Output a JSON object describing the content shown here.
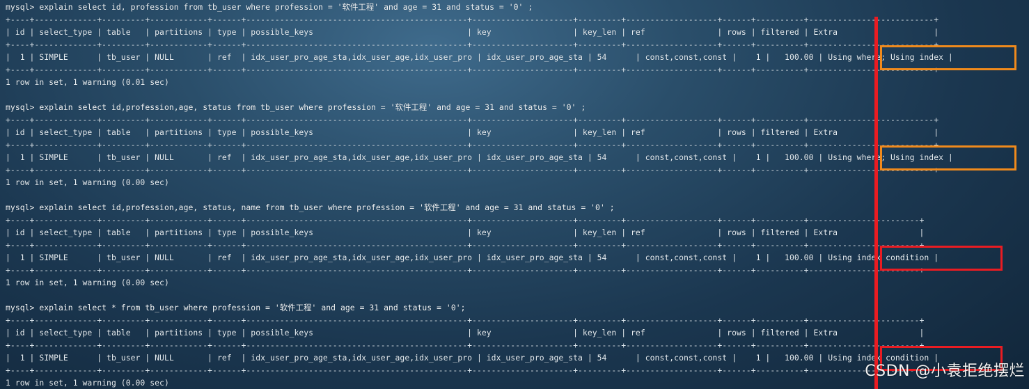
{
  "blocks": [
    {
      "command": "mysql> explain select id, profession from tb_user where profession = '软件工程' and age = 31 and status = '0' ;",
      "separator": "+----+-------------+---------+------------+------+----------------------------------------------+---------------------+---------+-------------------+------+----------+--------------------------+",
      "header": "| id | select_type | table   | partitions | type | possible_keys                                | key                 | key_len | ref               | rows | filtered | Extra                    |",
      "row": "|  1 | SIMPLE      | tb_user | NULL       | ref  | idx_user_pro_age_sta,idx_user_age,idx_user_pro | idx_user_pro_age_sta | 54      | const,const,const |    1 |   100.00 | Using where; Using index |",
      "footer": "1 row in set, 1 warning (0.01 sec)",
      "extra": "Using where; Using index"
    },
    {
      "command": "mysql> explain select id,profession,age, status from tb_user where profession = '软件工程' and age = 31 and status = '0' ;",
      "separator": "+----+-------------+---------+------------+------+----------------------------------------------+---------------------+---------+-------------------+------+----------+--------------------------+",
      "header": "| id | select_type | table   | partitions | type | possible_keys                                | key                 | key_len | ref               | rows | filtered | Extra                    |",
      "row": "|  1 | SIMPLE      | tb_user | NULL       | ref  | idx_user_pro_age_sta,idx_user_age,idx_user_pro | idx_user_pro_age_sta | 54      | const,const,const |    1 |   100.00 | Using where; Using index |",
      "footer": "1 row in set, 1 warning (0.00 sec)",
      "extra": "Using where; Using index"
    },
    {
      "command": "mysql> explain select id,profession,age, status, name from tb_user where profession = '软件工程' and age = 31 and status = '0' ;",
      "separator": "+----+-------------+---------+------------+------+----------------------------------------------+---------------------+---------+-------------------+------+----------+-----------------------+",
      "header": "| id | select_type | table   | partitions | type | possible_keys                                | key                 | key_len | ref               | rows | filtered | Extra                 |",
      "row": "|  1 | SIMPLE      | tb_user | NULL       | ref  | idx_user_pro_age_sta,idx_user_age,idx_user_pro | idx_user_pro_age_sta | 54      | const,const,const |    1 |   100.00 | Using index condition |",
      "footer": "1 row in set, 1 warning (0.00 sec)",
      "extra": "Using index condition"
    },
    {
      "command": "mysql> explain select * from tb_user where profession = '软件工程' and age = 31 and status = '0';",
      "separator": "+----+-------------+---------+------------+------+----------------------------------------------+---------------------+---------+-------------------+------+----------+-----------------------+",
      "header": "| id | select_type | table   | partitions | type | possible_keys                                | key                 | key_len | ref               | rows | filtered | Extra                 |",
      "row": "|  1 | SIMPLE      | tb_user | NULL       | ref  | idx_user_pro_age_sta,idx_user_age,idx_user_pro | idx_user_pro_age_sta | 54      | const,const,const |    1 |   100.00 | Using index condition |",
      "footer": "1 row in set, 1 warning (0.00 sec)",
      "extra": "Using index condition"
    }
  ],
  "watermark": "CSDN @小袁拒绝摆烂",
  "colors": {
    "background": "#1b3750",
    "text": "#e6edf2",
    "highlight_orange": "#f08a1c",
    "highlight_red": "#ea1c22",
    "marker_bar": "#ea1c22"
  }
}
